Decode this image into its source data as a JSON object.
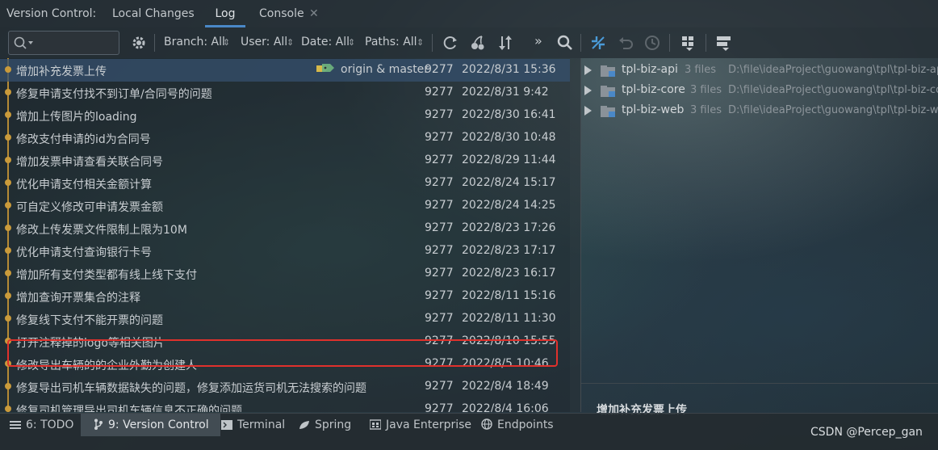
{
  "tabs": {
    "title": "Version Control:",
    "items": [
      "Local Changes",
      "Log",
      "Console"
    ],
    "active": "Log"
  },
  "toolbar": {
    "search_placeholder": "",
    "filters": {
      "branch": "Branch: All",
      "user": "User: All",
      "date": "Date: All",
      "paths": "Paths: All"
    },
    "more": "»"
  },
  "commits": [
    {
      "subject": "增加补充发票上传",
      "author": "9277",
      "date": "2022/8/31 15:36",
      "refs": "origin & master"
    },
    {
      "subject": "修复申请支付找不到订单/合同号的问题",
      "author": "9277",
      "date": "2022/8/31 9:42"
    },
    {
      "subject": "增加上传图片的loading",
      "author": "9277",
      "date": "2022/8/30 16:41"
    },
    {
      "subject": "修改支付申请的id为合同号",
      "author": "9277",
      "date": "2022/8/30 10:48"
    },
    {
      "subject": "增加发票申请查看关联合同号",
      "author": "9277",
      "date": "2022/8/29 11:44"
    },
    {
      "subject": "优化申请支付相关金额计算",
      "author": "9277",
      "date": "2022/8/24 15:17"
    },
    {
      "subject": "可自定义修改可申请发票金额",
      "author": "9277",
      "date": "2022/8/24 14:25"
    },
    {
      "subject": "修改上传发票文件限制上限为10M",
      "author": "9277",
      "date": "2022/8/23 17:26"
    },
    {
      "subject": "优化申请支付查询银行卡号",
      "author": "9277",
      "date": "2022/8/23 17:17"
    },
    {
      "subject": "增加所有支付类型都有线上线下支付",
      "author": "9277",
      "date": "2022/8/23 16:17"
    },
    {
      "subject": "增加查询开票集合的注释",
      "author": "9277",
      "date": "2022/8/11 15:16"
    },
    {
      "subject": "修复线下支付不能开票的问题",
      "author": "9277",
      "date": "2022/8/11 11:30"
    },
    {
      "subject": "打开注释掉的logo等相关图片",
      "author": "9277",
      "date": "2022/8/10 15:55"
    },
    {
      "subject": "修改导出车辆的的企业外勤为创建人",
      "author": "9277",
      "date": "2022/8/5 10:46"
    },
    {
      "subject": "修复导出司机车辆数据缺失的问题，修复添加运货司机无法搜索的问题",
      "author": "9277",
      "date": "2022/8/4 18:49"
    },
    {
      "subject": "修复司机管理导出司机车辆信息不正确的问题",
      "author": "9277",
      "date": "2022/8/4 16:06"
    }
  ],
  "changes": [
    {
      "module": "tpl-biz-api",
      "files": "3 files",
      "path": "D:\\file\\ideaProject\\guowang\\tpl\\tpl-biz-api"
    },
    {
      "module": "tpl-biz-core",
      "files": "3 files",
      "path": "D:\\file\\ideaProject\\guowang\\tpl\\tpl-biz-core"
    },
    {
      "module": "tpl-biz-web",
      "files": "3 files",
      "path": "D:\\file\\ideaProject\\guowang\\tpl\\tpl-biz-web"
    }
  ],
  "details": {
    "subject": "增加补充发票上传"
  },
  "bottom_tabs": [
    {
      "label": "6: TODO",
      "icon": "todo-list-icon"
    },
    {
      "label": "9: Version Control",
      "icon": "version-control-icon"
    },
    {
      "label": "Terminal",
      "icon": "terminal-icon"
    },
    {
      "label": "Spring",
      "icon": "spring-leaf-icon"
    },
    {
      "label": "Java Enterprise",
      "icon": "java-enterprise-icon"
    },
    {
      "label": "Endpoints",
      "icon": "globe-icon"
    }
  ],
  "watermark": "CSDN @Percep_gan",
  "colors": {
    "selection": "#36506e",
    "graph": "#c99a3b",
    "highlight": "#e0312c",
    "accent": "#4a88c7"
  }
}
